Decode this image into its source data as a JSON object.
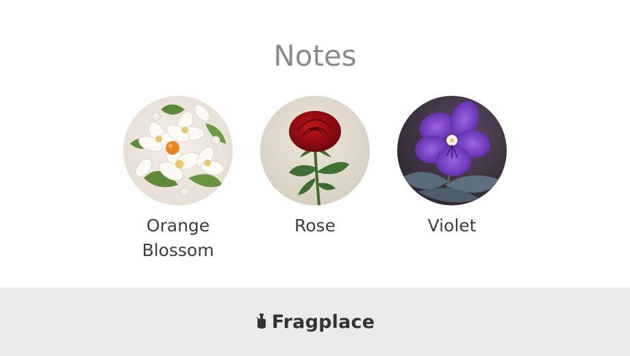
{
  "notes": {
    "title": "Notes",
    "items": [
      {
        "label": "Orange Blossom",
        "icon": "orange-blossom-image"
      },
      {
        "label": "Rose",
        "icon": "rose-image"
      },
      {
        "label": "Violet",
        "icon": "violet-image"
      }
    ]
  },
  "footer": {
    "brand": "Fragplace",
    "logo_icon": "perfume-bottle-icon"
  },
  "colors": {
    "title": "#8a8a8a",
    "label": "#3d3d3d",
    "footer_bg": "#ebebeb",
    "brand": "#333333",
    "rose_red": "#9b0f14",
    "violet_purple": "#7a3fc8",
    "blossom_white": "#f6f3ec"
  }
}
